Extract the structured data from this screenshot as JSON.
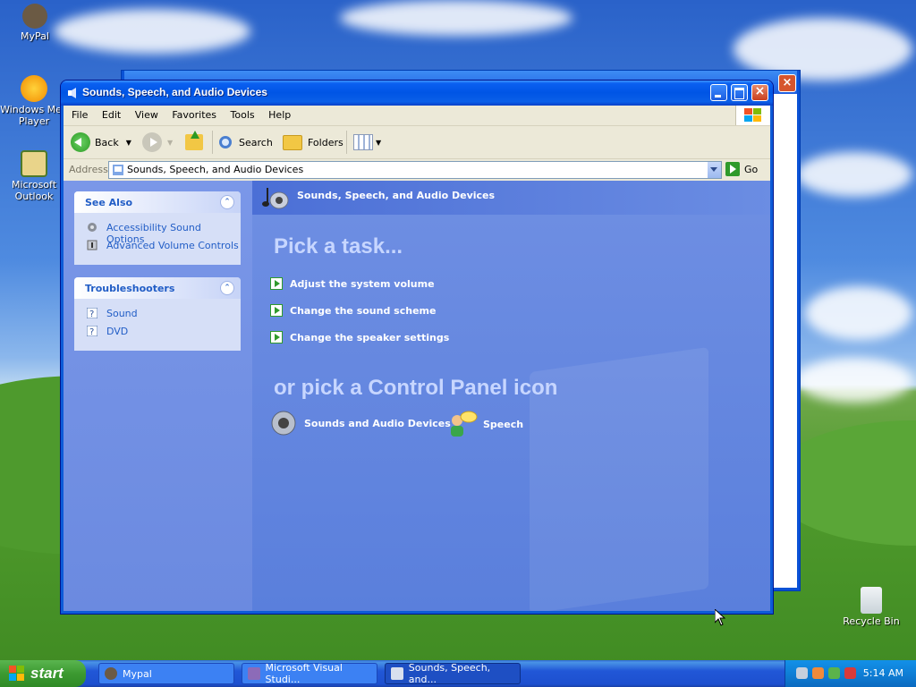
{
  "desktop": {
    "icons": [
      {
        "label": "MyPal",
        "icon": "raccoon-icon"
      },
      {
        "label": "Windows Media Player",
        "line1": "Windows Med",
        "line2": "Player",
        "icon": "media-player-icon"
      },
      {
        "label": "Microsoft Outlook",
        "line1": "Microsoft",
        "line2": "Outlook",
        "icon": "outlook-icon"
      },
      {
        "label": "Recycle Bin",
        "icon": "recycle-bin-icon"
      }
    ]
  },
  "window": {
    "title": "Sounds, Speech, and Audio Devices",
    "menu": [
      "File",
      "Edit",
      "View",
      "Favorites",
      "Tools",
      "Help"
    ],
    "toolbar": {
      "back": "Back",
      "search": "Search",
      "folders": "Folders"
    },
    "address": {
      "label": "Address",
      "value": "Sounds, Speech, and Audio Devices",
      "go": "Go"
    },
    "see_also": {
      "title": "See Also",
      "items": [
        "Accessibility Sound Options",
        "Advanced Volume Controls"
      ]
    },
    "troubleshooters": {
      "title": "Troubleshooters",
      "items": [
        "Sound",
        "DVD"
      ]
    },
    "category_header": "Sounds, Speech, and Audio Devices",
    "pick_task": "Pick a task...",
    "tasks": [
      "Adjust the system volume",
      "Change the sound scheme",
      "Change the speaker settings"
    ],
    "pick_icon": "or pick a Control Panel icon",
    "cp_icons": [
      "Sounds and Audio Devices",
      "Speech"
    ]
  },
  "taskbar": {
    "start": "start",
    "buttons": [
      "Mypal",
      "Microsoft Visual Studi...",
      "Sounds, Speech, and..."
    ],
    "clock": "5:14 AM"
  },
  "colors": {
    "xp_blue": "#0055e5",
    "taskpane_blue": "#6b8ae0",
    "link_blue": "#215dc6",
    "start_green": "#3c9a31"
  }
}
